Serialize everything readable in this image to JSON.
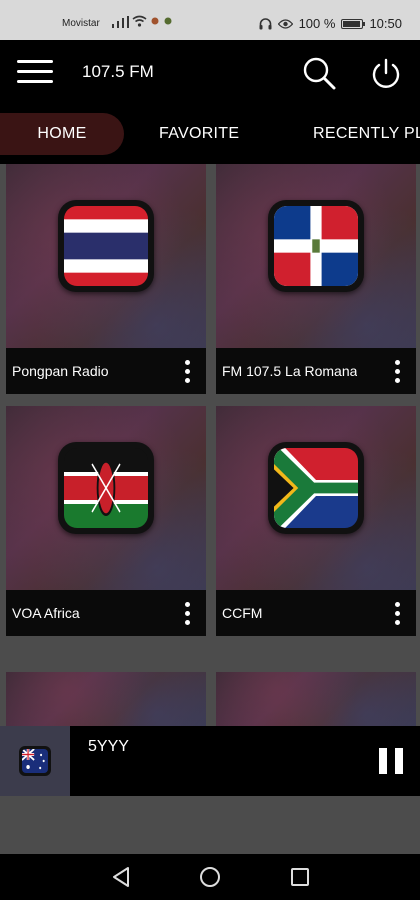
{
  "status_bar": {
    "carrier": "Movistar",
    "battery_text": "100 %",
    "time": "10:50",
    "icons": [
      "signal-icon",
      "wifi-icon",
      "notification-icon",
      "headphones-icon",
      "eye-icon",
      "battery-icon"
    ]
  },
  "app_bar": {
    "title": "107.5 FM",
    "icons": [
      "menu-icon",
      "search-icon",
      "power-icon"
    ]
  },
  "tabs": [
    {
      "label": "HOME",
      "active": true
    },
    {
      "label": "FAVORITE",
      "active": false
    },
    {
      "label": "RECENTLY PL",
      "active": false
    }
  ],
  "stations": [
    {
      "name": "Pongpan Radio",
      "flag": "thailand-flag"
    },
    {
      "name": "FM 107.5 La Romana",
      "flag": "dominican-republic-flag"
    },
    {
      "name": "VOA Africa",
      "flag": "kenya-flag"
    },
    {
      "name": "CCFM",
      "flag": "south-africa-flag"
    }
  ],
  "now_playing": {
    "title": "5YYY",
    "flag": "australia-flag",
    "state_icon": "pause-icon"
  },
  "nav_bar": {
    "icons": [
      "back-icon",
      "home-icon",
      "recents-icon"
    ]
  },
  "colors": {
    "active_tab_bg": "#3a1414",
    "bar_bg": "#000000",
    "page_bg": "#4c4c4c"
  }
}
